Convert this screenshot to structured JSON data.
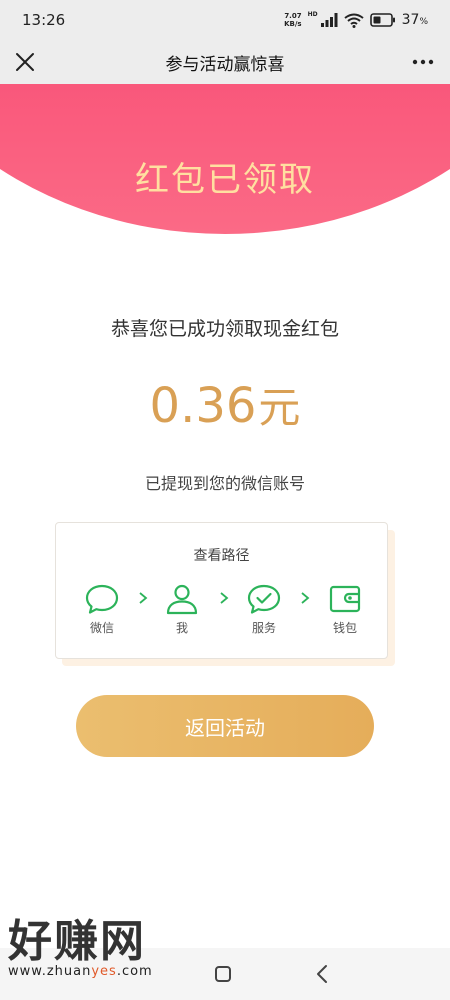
{
  "status_bar": {
    "time": "13:26",
    "net_speed_value": "7.07",
    "net_speed_unit": "KB/s",
    "hd": "HD",
    "battery_percent": "37",
    "battery_unit": "%"
  },
  "nav": {
    "title": "参与活动赢惊喜",
    "close_icon": "close-icon",
    "more_icon": "more-icon"
  },
  "banner": {
    "title": "红包已领取"
  },
  "result": {
    "congrats": "恭喜您已成功领取现金红包",
    "amount": "0.36",
    "unit": "元",
    "withdrawn_note": "已提现到您的微信账号"
  },
  "path_card": {
    "title": "查看路径",
    "steps": [
      {
        "label": "微信",
        "icon": "chat-bubble-icon"
      },
      {
        "label": "我",
        "icon": "user-icon"
      },
      {
        "label": "服务",
        "icon": "check-bubble-icon"
      },
      {
        "label": "钱包",
        "icon": "wallet-icon"
      }
    ]
  },
  "return_button": {
    "label": "返回活动"
  },
  "watermark": {
    "logo": "好赚网",
    "url_prefix": "www.zhuan",
    "url_highlight": "yes",
    "url_suffix": ".com"
  },
  "colors": {
    "banner": "#f63f66",
    "banner_title": "#ffdfa0",
    "amount": "#d9a055",
    "button": "#e8b463",
    "icon_green": "#2cb35a"
  }
}
